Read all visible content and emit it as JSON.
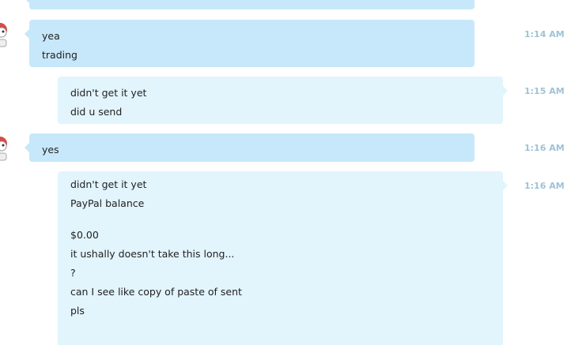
{
  "messages": [
    {
      "side": "in",
      "lines": [
        "yea",
        "trading"
      ],
      "time": "1:14 AM"
    },
    {
      "side": "out",
      "lines": [
        "didn't get it yet",
        "did u send"
      ],
      "time": "1:15 AM"
    },
    {
      "side": "in",
      "lines": [
        "yes"
      ],
      "time": "1:16 AM"
    },
    {
      "side": "out",
      "lines": [
        "didn't get it yet",
        "PayPal balance",
        "",
        "$0.00",
        "it ushally doesn't take this long...",
        "?",
        "can I see like copy of paste of sent",
        "pls"
      ],
      "time": "1:16 AM"
    }
  ],
  "colors": {
    "incoming_bubble": "#c7e8fa",
    "outgoing_bubble": "#e2f4fc",
    "timestamp": "#9fc3d6"
  },
  "icons": {
    "avatar": "avatar-icon"
  }
}
